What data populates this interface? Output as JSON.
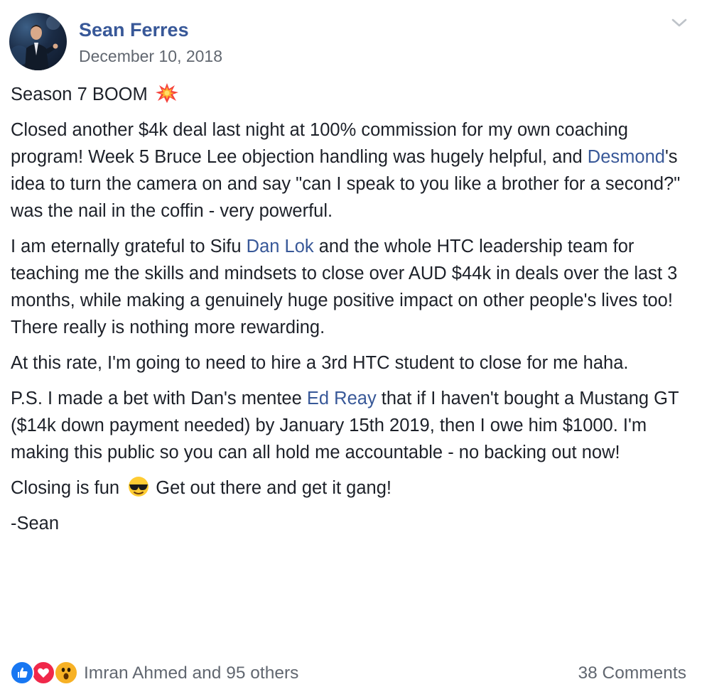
{
  "post": {
    "author": "Sean Ferres",
    "date": "December 10, 2018",
    "paragraphs": {
      "p1": {
        "text": "Season 7 BOOM"
      },
      "p2": {
        "a": "Closed another $4k deal last night at 100% commission for my own coaching program! Week 5 Bruce Lee objection handling was hugely helpful, and ",
        "mention": "Desmond",
        "b": "'s idea to turn the camera on and say \"can I speak to you like a brother for a second?\" was the nail in the coffin - very powerful."
      },
      "p3": {
        "a": "I am eternally grateful to Sifu ",
        "mention": "Dan Lok",
        "b": " and the whole HTC leadership team for teaching me the skills and mindsets to close over AUD $44k in deals over the last 3 months, while making a genuinely huge positive impact on other people's lives too! There really is nothing more rewarding."
      },
      "p4": {
        "text": "At this rate, I'm going to need to hire a 3rd HTC student to close for me haha."
      },
      "p5": {
        "a": "P.S. I made a bet with Dan's mentee ",
        "mention": "Ed Reay",
        "b": " that if I haven't bought a Mustang GT ($14k down payment needed) by January 15th 2019, then I owe him $1000. I'm making this public so you can all hold me accountable - no backing out now!"
      },
      "p6": {
        "a": "Closing is fun",
        "b": " Get out there and get it gang!"
      },
      "p7": {
        "text": "-Sean"
      }
    },
    "reactions": {
      "types": [
        "like-icon",
        "love-icon",
        "wow-icon"
      ],
      "summary": "Imran Ahmed and 95 others"
    },
    "comments_label": "38 Comments"
  },
  "icons": {
    "explosion": "explosion-emoji-icon",
    "sunglasses": "sunglasses-emoji-icon",
    "menu": "chevron-down-icon"
  },
  "colors": {
    "link": "#385898",
    "text": "#1d2129",
    "meta": "#616770",
    "like": "#1877f2",
    "love": "#f0284a",
    "wow": "#f7b125"
  }
}
